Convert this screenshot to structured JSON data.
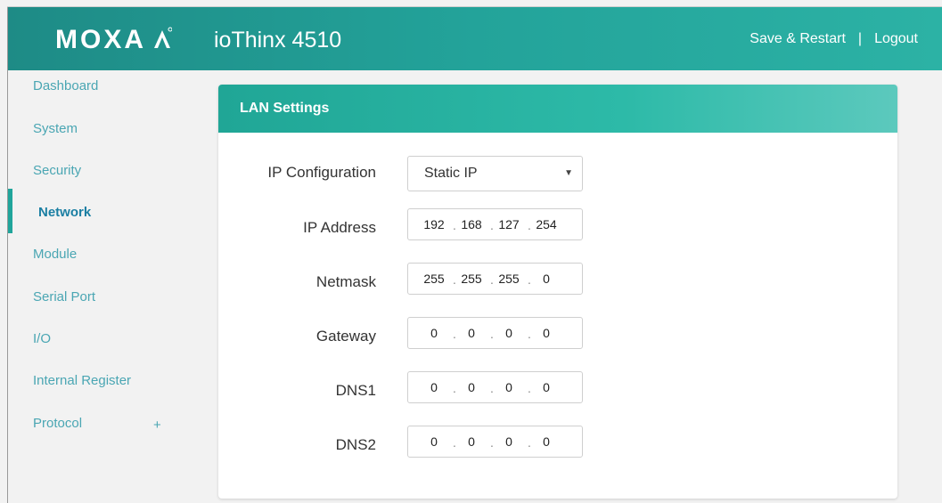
{
  "header": {
    "logo_text": "MOXA",
    "product_name": "ioThinx 4510",
    "save_restart": "Save & Restart",
    "separator": "|",
    "logout": "Logout"
  },
  "sidebar": {
    "items": [
      {
        "label": "Dashboard"
      },
      {
        "label": "System"
      },
      {
        "label": "Security"
      },
      {
        "label": "Network"
      },
      {
        "label": "Module"
      },
      {
        "label": "Serial Port"
      },
      {
        "label": "I/O"
      },
      {
        "label": "Internal Register"
      },
      {
        "label": "Protocol"
      }
    ],
    "active_item": "Network",
    "expand_symbol": "+"
  },
  "card": {
    "title": "LAN Settings",
    "fields": {
      "ip_config": {
        "label": "IP Configuration",
        "value": "Static IP"
      },
      "ip_address": {
        "label": "IP Address",
        "octets": [
          "192",
          "168",
          "127",
          "254"
        ]
      },
      "netmask": {
        "label": "Netmask",
        "octets": [
          "255",
          "255",
          "255",
          "0"
        ]
      },
      "gateway": {
        "label": "Gateway",
        "octets": [
          "0",
          "0",
          "0",
          "0"
        ]
      },
      "dns1": {
        "label": "DNS1",
        "octets": [
          "0",
          "0",
          "0",
          "0"
        ]
      },
      "dns2": {
        "label": "DNS2",
        "octets": [
          "0",
          "0",
          "0",
          "0"
        ]
      }
    }
  },
  "colors": {
    "accent": "#20a59b",
    "nav_text": "#4aa6b3",
    "nav_active": "#1b7fa3"
  },
  "icons": {
    "dropdown": "triangle-down"
  }
}
